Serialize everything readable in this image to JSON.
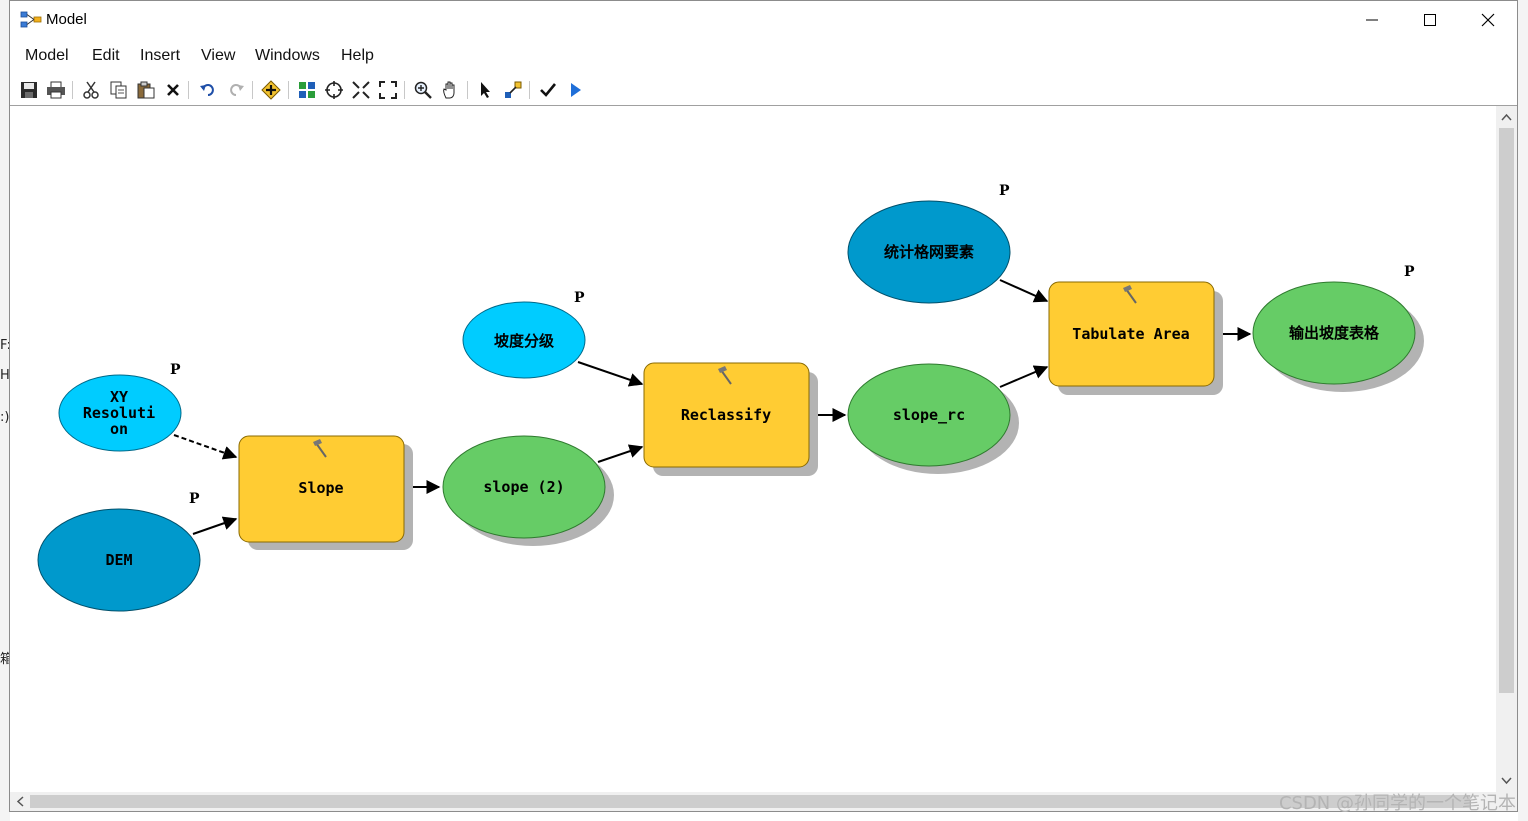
{
  "window": {
    "title": "Model",
    "controls": {
      "minimize": "—",
      "maximize": "☐",
      "close": "✕"
    }
  },
  "menu": [
    "Model",
    "Edit",
    "Insert",
    "View",
    "Windows",
    "Help"
  ],
  "toolbar_icons": [
    "save-icon",
    "print-icon",
    "cut-icon",
    "copy-icon",
    "paste-icon",
    "delete-icon",
    "undo-icon",
    "redo-icon",
    "add-data-icon",
    "auto-layout-icon",
    "full-extent-icon",
    "zoom-in-fixed-icon",
    "zoom-out-fixed-icon",
    "zoom-in-icon",
    "pan-icon",
    "select-icon",
    "connect-icon",
    "validate-icon",
    "run-icon"
  ],
  "model": {
    "nodes": {
      "xy_resolution": {
        "label_lines": [
          "XY",
          "Resoluti",
          "on"
        ],
        "type": "variable",
        "color": "#00ccff",
        "param": "P"
      },
      "dem": {
        "label": "DEM",
        "type": "input",
        "color": "#0099cc",
        "param": "P"
      },
      "slope_tool": {
        "label": "Slope",
        "type": "tool",
        "color": "#ffcc33"
      },
      "slope2": {
        "label": "slope (2)",
        "type": "derived",
        "color": "#66cc66"
      },
      "reclass_value": {
        "label": "坡度分级",
        "type": "variable",
        "color": "#00ccff",
        "param": "P"
      },
      "reclassify_tool": {
        "label": "Reclassify",
        "type": "tool",
        "color": "#ffcc33"
      },
      "slope_rc": {
        "label": "slope_rc",
        "type": "derived",
        "color": "#66cc66"
      },
      "zone_features": {
        "label": "统计格网要素",
        "type": "input",
        "color": "#0099cc",
        "param": "P"
      },
      "tabulate_tool": {
        "label": "Tabulate Area",
        "type": "tool",
        "color": "#ffcc33"
      },
      "output_table": {
        "label": "输出坡度表格",
        "type": "derived",
        "color": "#66cc66",
        "param": "P"
      }
    }
  },
  "background_text": [
    "F:",
    "H",
    ":)",
    "箱"
  ],
  "watermark": "CSDN @孙同学的一个笔记本"
}
